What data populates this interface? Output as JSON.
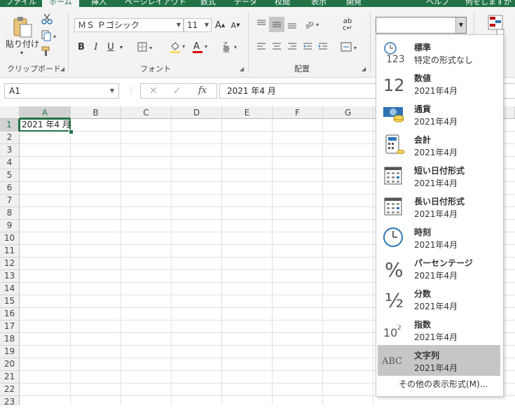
{
  "ribbon_tabs": [
    "ファイル",
    "ホーム",
    "挿入",
    "ページレイアウト",
    "数式",
    "データ",
    "校閲",
    "表示",
    "開発",
    "ヘルプ",
    "何をしますか"
  ],
  "clipboard": {
    "paste_label": "貼り付け",
    "group_label": "クリップボード"
  },
  "font": {
    "name": "ＭＳ Ｐゴシック",
    "size": "11",
    "group_label": "フォント",
    "bold": "B",
    "italic": "I",
    "underline": "U"
  },
  "alignment": {
    "group_label": "配置",
    "wrap_glyph": "ab c"
  },
  "formula_bar": {
    "name_box": "A1",
    "fx": "fx",
    "formula": "2021 年4 月"
  },
  "columns": [
    "A",
    "B",
    "C",
    "D",
    "E",
    "F",
    "G"
  ],
  "rows": [
    "1",
    "2",
    "3",
    "4",
    "5",
    "6",
    "7",
    "8",
    "9",
    "10",
    "11",
    "12",
    "13",
    "14",
    "15",
    "16",
    "17",
    "18",
    "19",
    "20",
    "21",
    "22",
    "23"
  ],
  "active_cell": {
    "ref": "A1",
    "value": "2021 年4 月"
  },
  "number_format_menu": {
    "items": [
      {
        "id": "general",
        "title": "標準",
        "sample": "特定の形式なし",
        "icon": "clock-123-icon"
      },
      {
        "id": "number",
        "title": "数値",
        "sample": "2021年4月",
        "icon": "number-12-icon"
      },
      {
        "id": "currency",
        "title": "通貨",
        "sample": "2021年4月",
        "icon": "money-icon"
      },
      {
        "id": "accounting",
        "title": "会計",
        "sample": " 2021年4月",
        "icon": "calculator-icon"
      },
      {
        "id": "short_date",
        "title": "短い日付形式",
        "sample": "2021年4月",
        "icon": "calendar-icon"
      },
      {
        "id": "long_date",
        "title": "長い日付形式",
        "sample": "2021年4月",
        "icon": "calendar-icon"
      },
      {
        "id": "time",
        "title": "時刻",
        "sample": "2021年4月",
        "icon": "clock-icon"
      },
      {
        "id": "percentage",
        "title": "パーセンテージ",
        "sample": "2021年4月",
        "icon": "percent-icon"
      },
      {
        "id": "fraction",
        "title": "分数",
        "sample": "2021年4月",
        "icon": "fraction-icon"
      },
      {
        "id": "scientific",
        "title": "指数",
        "sample": "2021年4月",
        "icon": "scientific-icon"
      },
      {
        "id": "text",
        "title": "文字列",
        "sample": "2021年4月",
        "icon": "abc-icon"
      }
    ],
    "selected": "text",
    "more_label": "その他の表示形式(M)..."
  },
  "colors": {
    "accent": "#217346",
    "ribbon_bg": "#f3f3f3",
    "selected_item": "#c6c6c6",
    "icon_blue": "#2e75b6"
  }
}
